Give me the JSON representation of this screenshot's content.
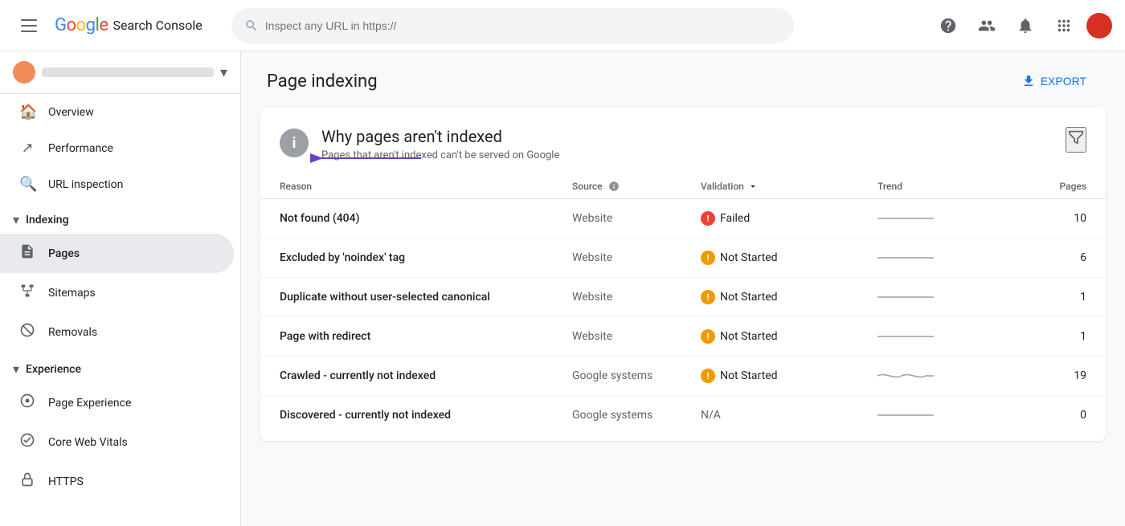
{
  "header": {
    "menu_label": "Menu",
    "logo_text": "Search Console",
    "search_placeholder": "Inspect any URL in https://",
    "help_label": "Help",
    "share_label": "Share",
    "notifications_label": "Notifications",
    "apps_label": "Google Apps"
  },
  "sidebar": {
    "property_name": "property name",
    "nav_items": [
      {
        "id": "overview",
        "label": "Overview",
        "icon": "🏠"
      },
      {
        "id": "performance",
        "label": "Performance",
        "icon": "↗"
      },
      {
        "id": "url-inspection",
        "label": "URL inspection",
        "icon": "🔍"
      }
    ],
    "sections": [
      {
        "id": "indexing",
        "label": "Indexing",
        "expanded": true,
        "items": [
          {
            "id": "pages",
            "label": "Pages",
            "active": true,
            "icon": "📄"
          },
          {
            "id": "sitemaps",
            "label": "Sitemaps",
            "icon": "🗺"
          },
          {
            "id": "removals",
            "label": "Removals",
            "icon": "🚫"
          }
        ]
      },
      {
        "id": "experience",
        "label": "Experience",
        "expanded": true,
        "items": [
          {
            "id": "page-experience",
            "label": "Page Experience",
            "icon": "⭐"
          },
          {
            "id": "core-web-vitals",
            "label": "Core Web Vitals",
            "icon": "🔄"
          },
          {
            "id": "https",
            "label": "HTTPS",
            "icon": "🔒"
          }
        ]
      }
    ]
  },
  "page": {
    "title": "Page indexing",
    "export_label": "EXPORT"
  },
  "card": {
    "title": "Why pages aren't indexed",
    "subtitle": "Pages that aren't indexed can't be served on Google",
    "columns": {
      "reason": "Reason",
      "source": "Source",
      "validation": "Validation",
      "trend": "Trend",
      "pages": "Pages"
    },
    "rows": [
      {
        "reason": "Not found (404)",
        "source": "Website",
        "validation_status": "failed",
        "validation_label": "Failed",
        "trend_type": "flat",
        "pages": 10,
        "has_arrow": true
      },
      {
        "reason": "Excluded by 'noindex' tag",
        "source": "Website",
        "validation_status": "not-started",
        "validation_label": "Not Started",
        "trend_type": "flat",
        "pages": 6
      },
      {
        "reason": "Duplicate without user-selected canonical",
        "source": "Website",
        "validation_status": "not-started",
        "validation_label": "Not Started",
        "trend_type": "flat",
        "pages": 1
      },
      {
        "reason": "Page with redirect",
        "source": "Website",
        "validation_status": "not-started",
        "validation_label": "Not Started",
        "trend_type": "flat",
        "pages": 1
      },
      {
        "reason": "Crawled - currently not indexed",
        "source": "Google systems",
        "validation_status": "not-started",
        "validation_label": "Not Started",
        "trend_type": "wavy",
        "pages": 19
      },
      {
        "reason": "Discovered - currently not indexed",
        "source": "Google systems",
        "validation_status": "na",
        "validation_label": "N/A",
        "trend_type": "flat",
        "pages": 0
      }
    ]
  }
}
